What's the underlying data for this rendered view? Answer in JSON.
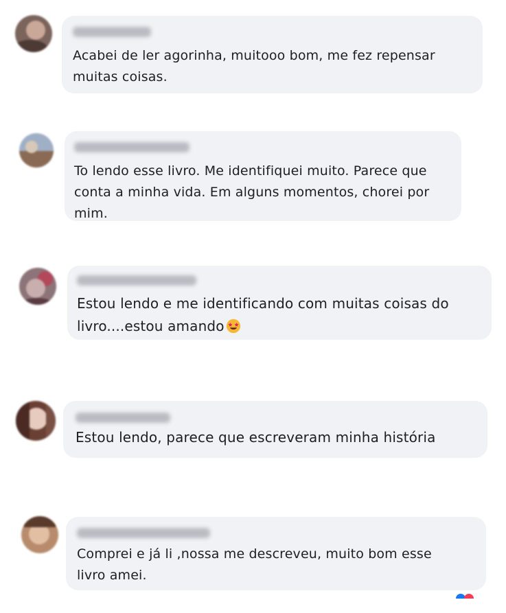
{
  "comments": [
    {
      "name": "",
      "text": "Acabei de ler agorinha, muitooo bom, me fez repensar\nmuitas coisas.",
      "emoji": "",
      "avatar_colors": [
        "#6f5a52",
        "#c9b3a8"
      ]
    },
    {
      "name": "",
      "text": "To lendo esse livro. Me identifiquei muito. Parece que\nconta a minha vida. Em alguns momentos, chorei por\nmim.",
      "emoji": "",
      "avatar_colors": [
        "#8aa0b8",
        "#8a6f5a"
      ]
    },
    {
      "name": "",
      "text": "Estou lendo e me identificando com muitas coisas do\nlivro....estou amando",
      "emoji": "star-struck-face",
      "avatar_colors": [
        "#5b3b44",
        "#a88a8c"
      ]
    },
    {
      "name": "",
      "text": "Estou lendo, parece que escreveram minha história",
      "emoji": "",
      "avatar_colors": [
        "#e3c9c0",
        "#5e3b31"
      ]
    },
    {
      "name": "",
      "text": "Comprei e já li ,nossa me descreveu, muito bom esse\nlivro amei.",
      "emoji": "",
      "avatar_colors": [
        "#c7a083",
        "#5a3a2b"
      ]
    }
  ],
  "colors": {
    "bubble_bg": "#f0f2f5",
    "text": "#1c1e21",
    "name_blur": "#b9bcc2",
    "reaction_like": "#1877f2",
    "reaction_love": "#f33e58"
  }
}
